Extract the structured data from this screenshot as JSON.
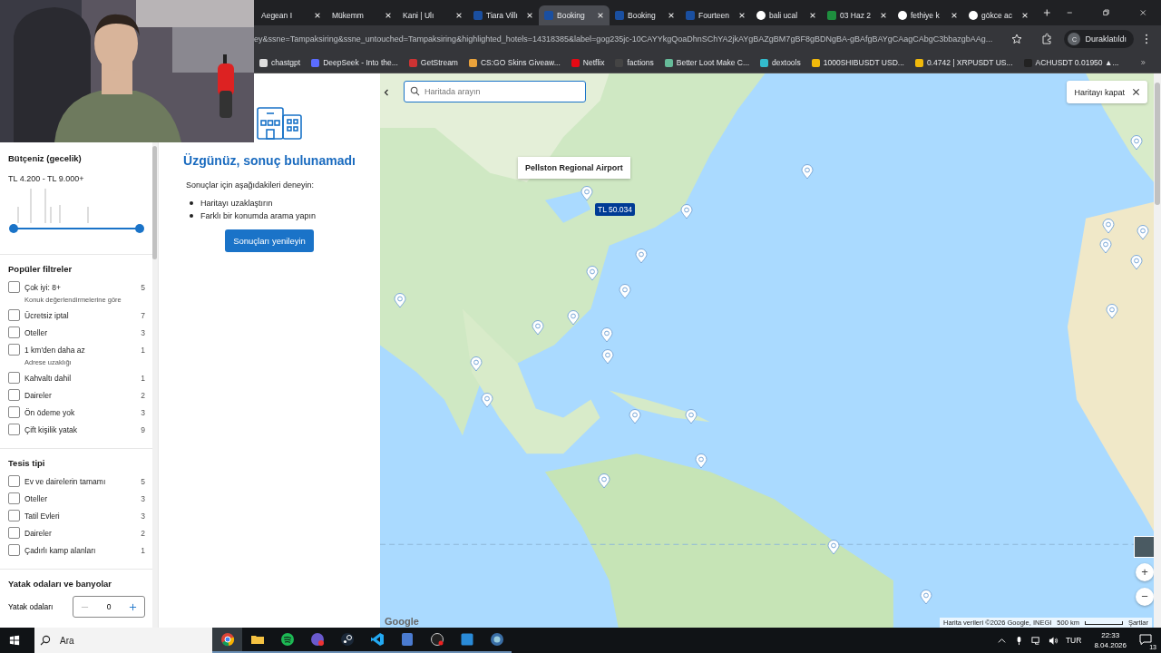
{
  "browser": {
    "tabs": [
      {
        "title": "Aegean I",
        "kind": "plain",
        "selected": false
      },
      {
        "title": "Mükemm",
        "kind": "plain",
        "selected": false
      },
      {
        "title": "Kani | Ulı",
        "kind": "plain",
        "selected": false
      },
      {
        "title": "Tiara Villı",
        "kind": "booking",
        "selected": false
      },
      {
        "title": "Booking",
        "kind": "booking",
        "selected": true
      },
      {
        "title": "Booking",
        "kind": "booking",
        "selected": false
      },
      {
        "title": "Fourteen",
        "kind": "booking",
        "selected": false
      },
      {
        "title": "bali ucal",
        "kind": "google",
        "selected": false
      },
      {
        "title": "03 Haz 2",
        "kind": "sheet",
        "selected": false
      },
      {
        "title": "fethiye k",
        "kind": "google",
        "selected": false
      },
      {
        "title": "gökce ac",
        "kind": "google",
        "selected": false
      }
    ],
    "url": "ey&ssne=Tampaksiring&ssne_untouched=Tampaksiring&highlighted_hotels=14318385&label=gog235jc-10CAYYkgQoaDhnSChYA2jkAYgBAZgBM7gBF8gBDNgBA-gBAfgBAYgCAagCAbgC3bbazgbAAg...",
    "profile": {
      "initial": "C",
      "status": "Duraklatıldı"
    },
    "bookmarks": [
      "chastgpt",
      "DeepSeek - Into the...",
      "GetStream",
      "CS:GO Skins Giveaw...",
      "Netflix",
      "factions",
      "Better Loot Make C...",
      "dextools",
      "1000SHIBUSDT USD...",
      "0.4742 | XRPUSDT US...",
      "ACHUSDT 0.01950 ▲..."
    ]
  },
  "filters": {
    "budget": {
      "title": "Bütçeniz (gecelik)",
      "range": "TL 4.200 - TL 9.000+",
      "thumbs": [
        {
          "level": 0
        },
        {
          "level": 1
        }
      ]
    },
    "sections": [
      {
        "title": "Popüler filtreler",
        "items": [
          {
            "label": "Çok iyi: 8+",
            "count": "5",
            "note": "Konuk değerlendirmelerine göre",
            "checked": false
          },
          {
            "label": "Ücretsiz iptal",
            "count": "7",
            "checked": false
          },
          {
            "label": "Oteller",
            "count": "3",
            "checked": false
          },
          {
            "label": "1 km'den daha az",
            "count": "1",
            "note": "Adrese uzaklığı",
            "checked": false
          },
          {
            "label": "Kahvaltı dahil",
            "count": "1",
            "checked": false
          },
          {
            "label": "Daireler",
            "count": "2",
            "checked": false
          },
          {
            "label": "Ön ödeme yok",
            "count": "3",
            "checked": false
          },
          {
            "label": "Çift kişilik yatak",
            "count": "9",
            "checked": false
          }
        ]
      },
      {
        "title": "Tesis tipi",
        "items": [
          {
            "label": "Ev ve dairelerin tamamı",
            "count": "5",
            "checked": false
          },
          {
            "label": "Oteller",
            "count": "3",
            "checked": false
          },
          {
            "label": "Tatil Evleri",
            "count": "3",
            "checked": false
          },
          {
            "label": "Daireler",
            "count": "2",
            "checked": false
          },
          {
            "label": "Çadırlı kamp alanları",
            "count": "1",
            "checked": false
          }
        ]
      }
    ],
    "rooms": {
      "title": "Yatak odaları ve banyolar",
      "steppers": [
        {
          "label": "Yatak odaları",
          "value": "0"
        }
      ]
    }
  },
  "results": {
    "title": "Üzgünüz, sonuç bulunamadı",
    "intro": "Sonuçlar için aşağıdakileri deneyin:",
    "tips": [
      "Haritayı uzaklaştırın",
      "Farklı bir konumda arama yapın"
    ],
    "button": "Sonuçları yenileyin"
  },
  "map": {
    "search": {
      "placeholder": "Haritada arayın"
    },
    "close": "Haritayı kapat",
    "popup": "Pellston Regional Airport",
    "price": "TL 50.034",
    "zoom_in": "+",
    "zoom_out": "−",
    "logo": "Google",
    "attribution": "Harita verileri ©2026 Google, INEGI",
    "scale": "500 km",
    "terms": "Şartlar"
  },
  "taskbar": {
    "search": "Ara",
    "language": "TUR",
    "time": "22:33",
    "date": "8.04.2026",
    "notifications": "13"
  }
}
